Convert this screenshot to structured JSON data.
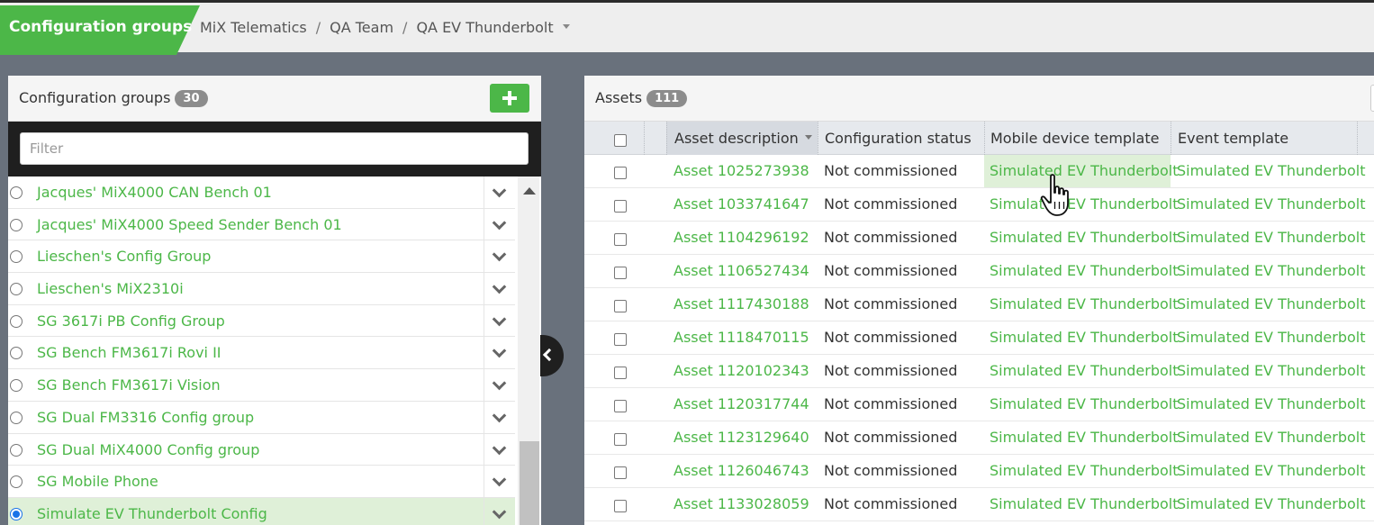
{
  "header": {
    "title": "Configuration groups",
    "breadcrumb": [
      "MiX Telematics",
      "QA Team",
      "QA EV Thunderbolt"
    ],
    "breadcrumb_sep": "/",
    "accent_color": "#4cb748"
  },
  "left_panel": {
    "title": "Configuration groups",
    "count": "30",
    "add_icon": "plus-icon",
    "filter_placeholder": "Filter",
    "groups": [
      {
        "label": "Jacques' MiX4000 CAN Bench 01",
        "selected": false
      },
      {
        "label": "Jacques' MiX4000 Speed Sender Bench 01",
        "selected": false
      },
      {
        "label": "Lieschen's Config Group",
        "selected": false
      },
      {
        "label": "Lieschen's MiX2310i",
        "selected": false
      },
      {
        "label": "SG 3617i PB Config Group",
        "selected": false
      },
      {
        "label": "SG Bench FM3617i Rovi II",
        "selected": false
      },
      {
        "label": "SG Bench FM3617i Vision",
        "selected": false
      },
      {
        "label": "SG Dual FM3316 Config group",
        "selected": false
      },
      {
        "label": "SG Dual MiX4000 Config group",
        "selected": false
      },
      {
        "label": "SG Mobile Phone",
        "selected": false
      },
      {
        "label": "Simulate EV Thunderbolt Config",
        "selected": true
      }
    ]
  },
  "right_panel": {
    "title": "Assets",
    "count": "111",
    "columns": [
      "Asset description",
      "Configuration status",
      "Mobile device template",
      "Event template"
    ],
    "rows": [
      {
        "asset": "Asset 1025273938",
        "status": "Not commissioned",
        "mobile": "Simulated EV Thunderbolt",
        "event": "Simulated EV Thunderbolt"
      },
      {
        "asset": "Asset 1033741647",
        "status": "Not commissioned",
        "mobile": "Simulated EV Thunderbolt",
        "event": "Simulated EV Thunderbolt"
      },
      {
        "asset": "Asset 1104296192",
        "status": "Not commissioned",
        "mobile": "Simulated EV Thunderbolt",
        "event": "Simulated EV Thunderbolt"
      },
      {
        "asset": "Asset 1106527434",
        "status": "Not commissioned",
        "mobile": "Simulated EV Thunderbolt",
        "event": "Simulated EV Thunderbolt"
      },
      {
        "asset": "Asset 1117430188",
        "status": "Not commissioned",
        "mobile": "Simulated EV Thunderbolt",
        "event": "Simulated EV Thunderbolt"
      },
      {
        "asset": "Asset 1118470115",
        "status": "Not commissioned",
        "mobile": "Simulated EV Thunderbolt",
        "event": "Simulated EV Thunderbolt"
      },
      {
        "asset": "Asset 1120102343",
        "status": "Not commissioned",
        "mobile": "Simulated EV Thunderbolt",
        "event": "Simulated EV Thunderbolt"
      },
      {
        "asset": "Asset 1120317744",
        "status": "Not commissioned",
        "mobile": "Simulated EV Thunderbolt",
        "event": "Simulated EV Thunderbolt"
      },
      {
        "asset": "Asset 1123129640",
        "status": "Not commissioned",
        "mobile": "Simulated EV Thunderbolt",
        "event": "Simulated EV Thunderbolt"
      },
      {
        "asset": "Asset 1126046743",
        "status": "Not commissioned",
        "mobile": "Simulated EV Thunderbolt",
        "event": "Simulated EV Thunderbolt"
      },
      {
        "asset": "Asset 1133028059",
        "status": "Not commissioned",
        "mobile": "Simulated EV Thunderbolt",
        "event": "Simulated EV Thunderbolt"
      }
    ]
  }
}
